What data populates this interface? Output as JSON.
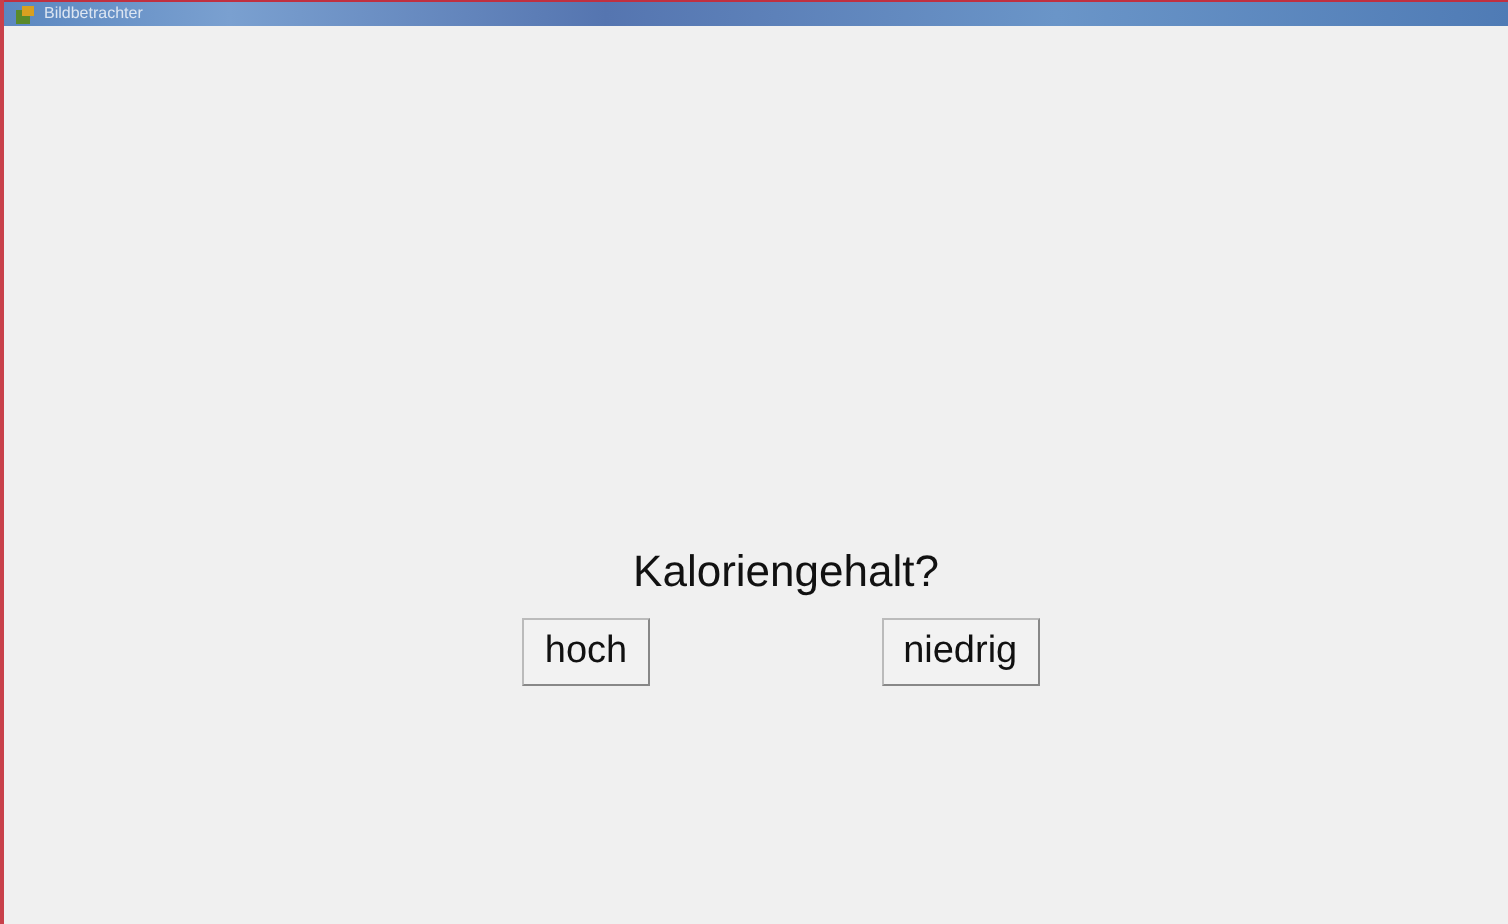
{
  "window": {
    "title": "Bildbetrachter"
  },
  "question": "Kaloriengehalt?",
  "buttons": [
    "hoch",
    "niedrig"
  ]
}
